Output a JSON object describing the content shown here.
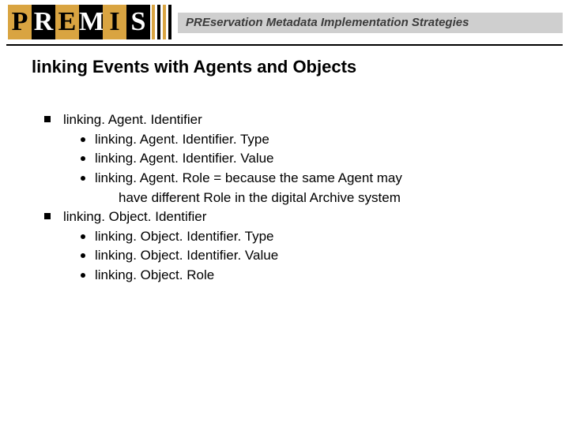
{
  "header": {
    "logo_letters": [
      "P",
      "R",
      "E",
      "M",
      "I",
      "S"
    ],
    "tagline": "PREservation Metadata Implementation Strategies"
  },
  "title": "linking Events with Agents and Objects",
  "bullets": [
    {
      "text": "linking. Agent. Identifier",
      "children": [
        {
          "text": "linking. Agent. Identifier. Type"
        },
        {
          "text": "linking. Agent. Identifier. Value"
        },
        {
          "text": "linking. Agent. Role = because the same Agent may",
          "cont": "have different Role in the digital Archive system"
        }
      ]
    },
    {
      "text": "linking. Object. Identifier",
      "children": [
        {
          "text": "linking. Object. Identifier. Type"
        },
        {
          "text": "linking. Object. Identifier. Value"
        },
        {
          "text": "linking. Object. Role"
        }
      ]
    }
  ]
}
